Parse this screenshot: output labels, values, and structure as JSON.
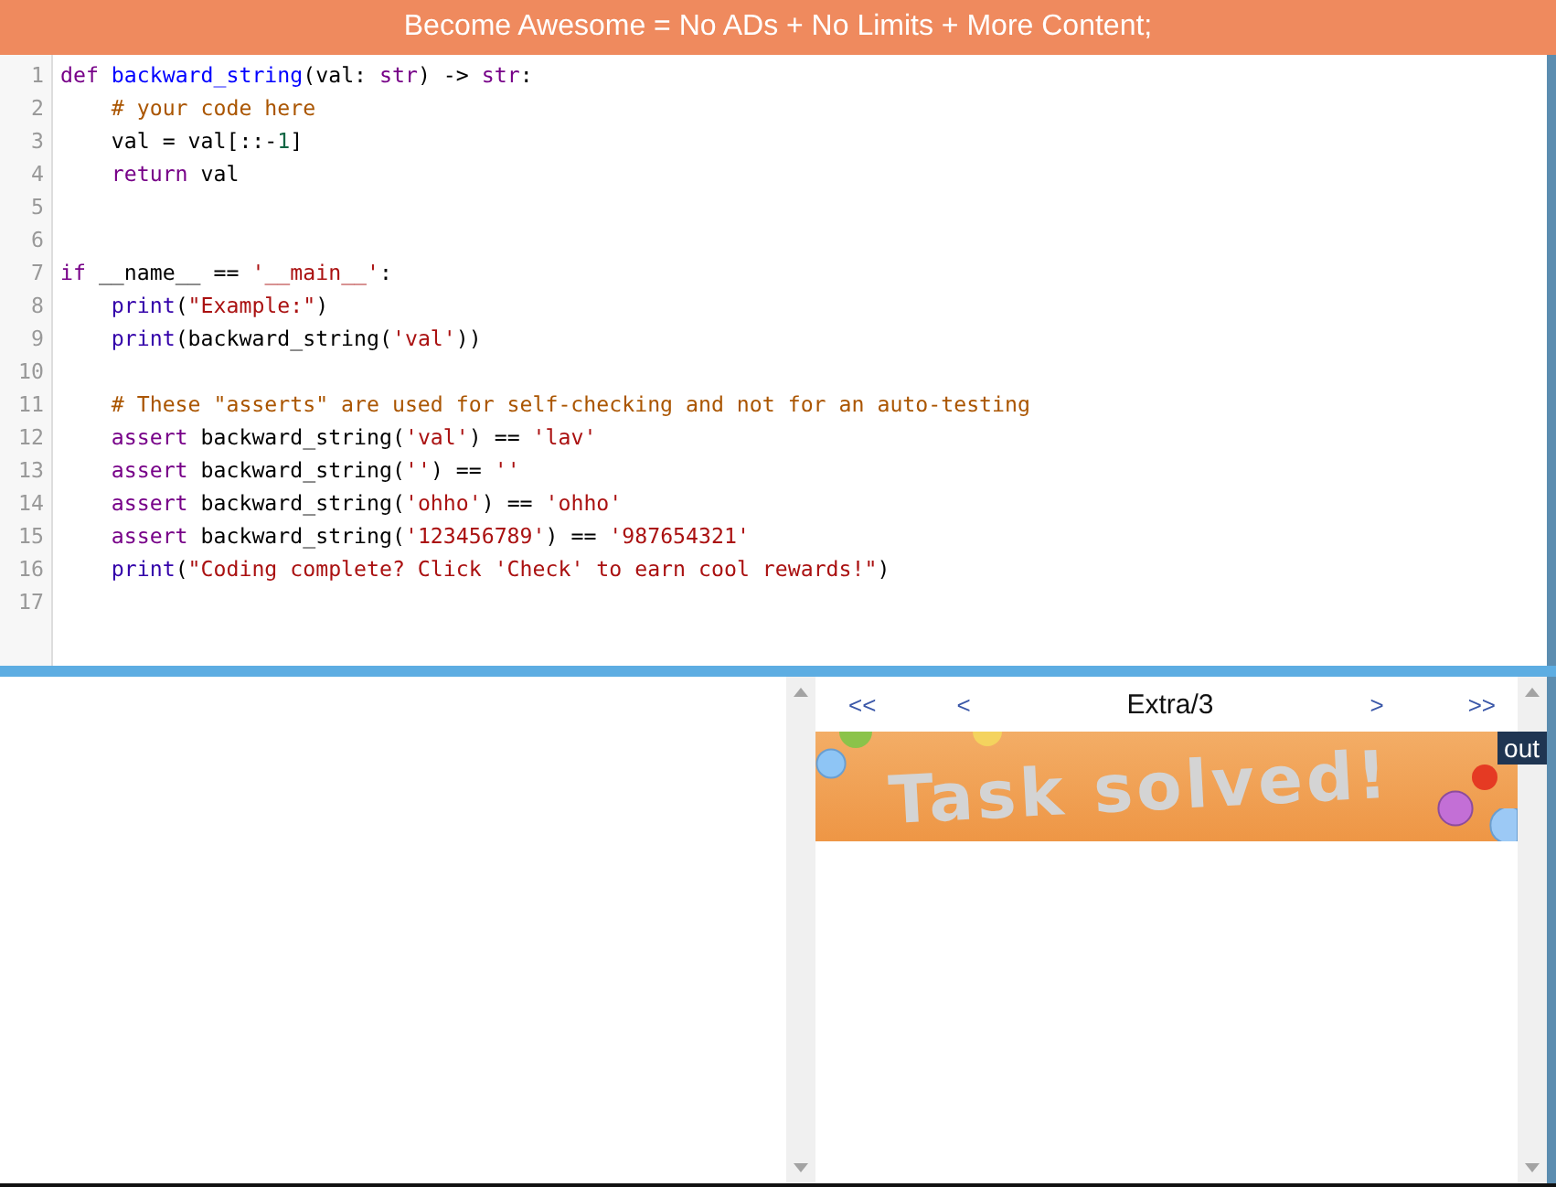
{
  "banner": {
    "text": "Become Awesome = No ADs + No Limits + More Content;"
  },
  "editor": {
    "lines": [
      {
        "number": "1",
        "indented": false,
        "tokens": [
          {
            "t": "def ",
            "kind": "keyword"
          },
          {
            "t": "backward_string",
            "kind": "def"
          },
          {
            "t": "(val: ",
            "kind": "text"
          },
          {
            "t": "str",
            "kind": "keyword"
          },
          {
            "t": ") -> ",
            "kind": "text"
          },
          {
            "t": "str",
            "kind": "keyword"
          },
          {
            "t": ":",
            "kind": "text"
          }
        ]
      },
      {
        "number": "2",
        "indented": true,
        "tokens": [
          {
            "t": "# your code here",
            "kind": "comment"
          }
        ]
      },
      {
        "number": "3",
        "indented": true,
        "tokens": [
          {
            "t": "val = val[::-",
            "kind": "text"
          },
          {
            "t": "1",
            "kind": "number"
          },
          {
            "t": "]",
            "kind": "text"
          }
        ]
      },
      {
        "number": "4",
        "indented": true,
        "tokens": [
          {
            "t": "return",
            "kind": "keyword"
          },
          {
            "t": " val",
            "kind": "text"
          }
        ]
      },
      {
        "number": "5"
      },
      {
        "number": "6"
      },
      {
        "number": "7",
        "indented": false,
        "tokens": [
          {
            "t": "if",
            "kind": "keyword"
          },
          {
            "t": " __name__ == ",
            "kind": "text"
          },
          {
            "t": "'__main__'",
            "kind": "string"
          },
          {
            "t": ":",
            "kind": "text"
          }
        ]
      },
      {
        "number": "8",
        "indented": true,
        "tokens": [
          {
            "t": "print",
            "kind": "builtin"
          },
          {
            "t": "(",
            "kind": "text"
          },
          {
            "t": "\"Example:\"",
            "kind": "string"
          },
          {
            "t": ")",
            "kind": "text"
          }
        ]
      },
      {
        "number": "9",
        "indented": true,
        "tokens": [
          {
            "t": "print",
            "kind": "builtin"
          },
          {
            "t": "(backward_string(",
            "kind": "text"
          },
          {
            "t": "'val'",
            "kind": "string"
          },
          {
            "t": "))",
            "kind": "text"
          }
        ]
      },
      {
        "number": "10"
      },
      {
        "number": "11",
        "indented": true,
        "tokens": [
          {
            "t": "# These \"asserts\" are used for self-checking and not for an auto-testing",
            "kind": "comment"
          }
        ]
      },
      {
        "number": "12",
        "indented": true,
        "tokens": [
          {
            "t": "assert",
            "kind": "keyword"
          },
          {
            "t": " backward_string(",
            "kind": "text"
          },
          {
            "t": "'val'",
            "kind": "string"
          },
          {
            "t": ") == ",
            "kind": "text"
          },
          {
            "t": "'lav'",
            "kind": "string"
          }
        ]
      },
      {
        "number": "13",
        "indented": true,
        "tokens": [
          {
            "t": "assert",
            "kind": "keyword"
          },
          {
            "t": " backward_string(",
            "kind": "text"
          },
          {
            "t": "''",
            "kind": "string"
          },
          {
            "t": ") == ",
            "kind": "text"
          },
          {
            "t": "''",
            "kind": "string"
          }
        ]
      },
      {
        "number": "14",
        "indented": true,
        "tokens": [
          {
            "t": "assert",
            "kind": "keyword"
          },
          {
            "t": " backward_string(",
            "kind": "text"
          },
          {
            "t": "'ohho'",
            "kind": "string"
          },
          {
            "t": ") == ",
            "kind": "text"
          },
          {
            "t": "'ohho'",
            "kind": "string"
          }
        ]
      },
      {
        "number": "15",
        "indented": true,
        "tokens": [
          {
            "t": "assert",
            "kind": "keyword"
          },
          {
            "t": " backward_string(",
            "kind": "text"
          },
          {
            "t": "'123456789'",
            "kind": "string"
          },
          {
            "t": ") == ",
            "kind": "text"
          },
          {
            "t": "'987654321'",
            "kind": "string"
          }
        ]
      },
      {
        "number": "16",
        "indented": true,
        "tokens": [
          {
            "t": "print",
            "kind": "builtin"
          },
          {
            "t": "(",
            "kind": "text"
          },
          {
            "t": "\"Coding complete? Click 'Check' to earn cool rewards!\"",
            "kind": "string"
          },
          {
            "t": ")",
            "kind": "text"
          }
        ]
      },
      {
        "number": "17"
      }
    ]
  },
  "pager": {
    "first": "<<",
    "prev": "<",
    "title": "Extra/3",
    "next": ">",
    "last": ">>"
  },
  "result": {
    "banner_text": "Task solved!",
    "out_label": "out"
  }
}
